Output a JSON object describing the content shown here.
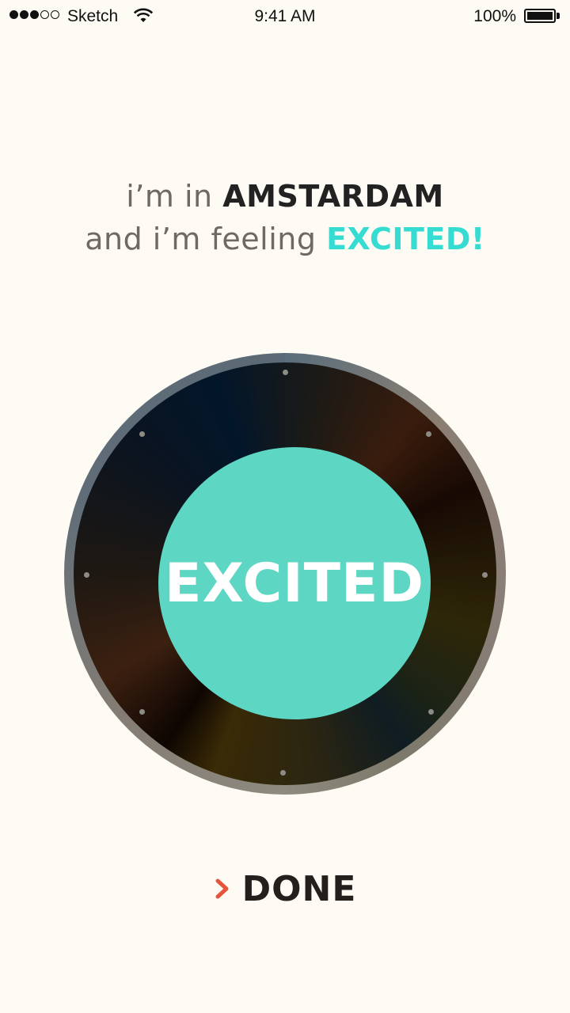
{
  "status_bar": {
    "signal_dots_on": 3,
    "signal_dots_total": 5,
    "carrier": "Sketch",
    "time": "9:41 AM",
    "battery_percent": "100%"
  },
  "headline": {
    "line1_prefix": "i’m in",
    "city": "AMSTARDAM",
    "line2_prefix": "and i’m feeling",
    "mood": "EXCITED!"
  },
  "dial": {
    "selected_mood": "EXCITED",
    "tick_count": 8
  },
  "done": {
    "label": "DONE",
    "icon": "chevron-right-icon"
  },
  "colors": {
    "background": "#fdfbf3",
    "accent_mood": "#36dcd1",
    "center_disc": "#5dd6c3",
    "done_chevron": "#e4553a",
    "dark_text": "#231f1c",
    "muted_text": "#6d6a66"
  }
}
